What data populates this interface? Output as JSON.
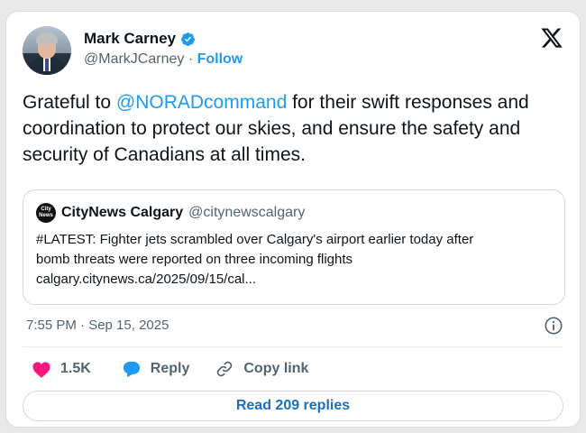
{
  "author": {
    "name": "Mark Carney",
    "handle": "@MarkJCarney",
    "separator": " · ",
    "follow_label": "Follow"
  },
  "tweet": {
    "text_before": "Grateful to ",
    "mention": "@NORADcommand",
    "text_after": " for their swift responses and coordination to protect our skies, and ensure the safety and security of Canadians at all times."
  },
  "quote": {
    "avatar_text": "City News",
    "name": "CityNews Calgary",
    "handle": "@citynewscalgary",
    "lines": [
      "#LATEST: Fighter jets scrambled over Calgary's airport earlier today after",
      "bomb threats were reported on three incoming flights",
      "calgary.citynews.ca/2025/09/15/cal..."
    ]
  },
  "timestamp": "7:55 PM · Sep 15, 2025",
  "actions": {
    "like_count": "1.5K",
    "reply_label": "Reply",
    "copy_label": "Copy link"
  },
  "read_replies_label": "Read 209 replies",
  "colors": {
    "link": "#1d9bf0",
    "like": "#f91880",
    "reply_icon": "#1d9bf0",
    "button_text": "#1d6fb8"
  },
  "icons": {
    "verified": "verified-badge-icon",
    "platform": "x-logo-icon",
    "info": "info-icon",
    "like": "heart-icon",
    "reply": "speech-bubble-icon",
    "copy": "link-icon"
  }
}
